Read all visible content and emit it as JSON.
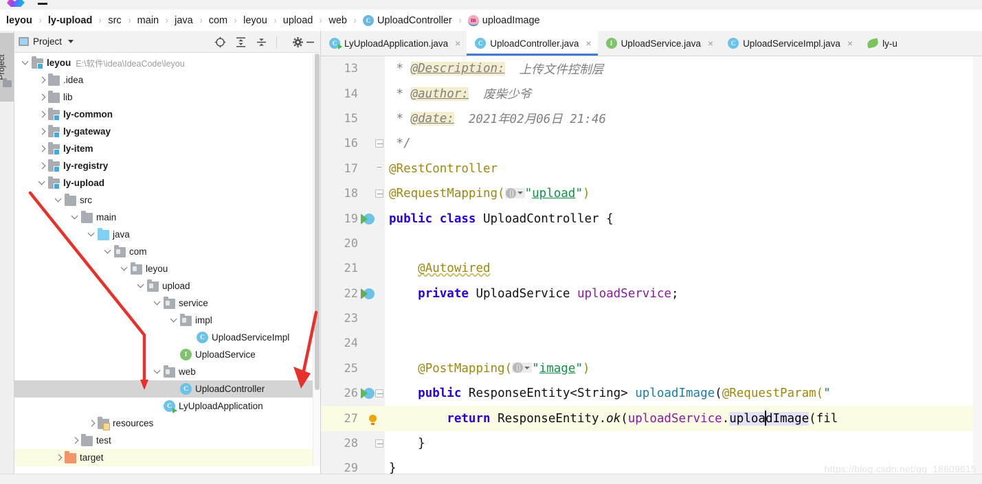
{
  "window": {
    "app": "IntelliJ IDEA",
    "watermark": "https://blog.csdn.net/qq_18609615"
  },
  "breadcrumb": {
    "items": [
      {
        "label": "leyou",
        "bold": true,
        "icon": ""
      },
      {
        "label": "ly-upload",
        "bold": true,
        "icon": ""
      },
      {
        "label": "src",
        "bold": false,
        "icon": ""
      },
      {
        "label": "main",
        "bold": false,
        "icon": ""
      },
      {
        "label": "java",
        "bold": false,
        "icon": ""
      },
      {
        "label": "com",
        "bold": false,
        "icon": ""
      },
      {
        "label": "leyou",
        "bold": false,
        "icon": ""
      },
      {
        "label": "upload",
        "bold": false,
        "icon": ""
      },
      {
        "label": "web",
        "bold": false,
        "icon": ""
      },
      {
        "label": "UploadController",
        "bold": false,
        "icon": "class-icon",
        "icon_letter": "C"
      },
      {
        "label": "uploadImage",
        "bold": false,
        "icon": "method-icon",
        "icon_letter": "m"
      }
    ],
    "separator": "›"
  },
  "tool_stripe": {
    "project_label": "Project",
    "folder_icon": "folder-icon"
  },
  "project_panel": {
    "title": "Project",
    "title_icon": "project-window-icon",
    "dropdown_icon": "chevron-down-icon",
    "toolbar": [
      {
        "name": "locate-target-icon",
        "tooltip": "Select Opened File"
      },
      {
        "name": "expand-all-icon",
        "tooltip": "Expand All"
      },
      {
        "name": "collapse-all-icon",
        "tooltip": "Collapse All"
      },
      {
        "name": "settings-gear-icon",
        "tooltip": "Settings"
      },
      {
        "name": "minimize-icon",
        "tooltip": "Hide"
      }
    ],
    "tree": [
      {
        "label": "leyou",
        "note": "E:\\软件\\idea\\IdeaCode\\leyou",
        "indent": 0,
        "arrow": "down",
        "icon": "module-folder-icon",
        "bold": true
      },
      {
        "label": ".idea",
        "note": "",
        "indent": 1,
        "arrow": "right",
        "icon": "folder-icon",
        "bold": false
      },
      {
        "label": "lib",
        "note": "",
        "indent": 1,
        "arrow": "right",
        "icon": "folder-icon",
        "bold": false
      },
      {
        "label": "ly-common",
        "note": "",
        "indent": 1,
        "arrow": "right",
        "icon": "module-folder-icon",
        "bold": true
      },
      {
        "label": "ly-gateway",
        "note": "",
        "indent": 1,
        "arrow": "right",
        "icon": "module-folder-icon",
        "bold": true
      },
      {
        "label": "ly-item",
        "note": "",
        "indent": 1,
        "arrow": "right",
        "icon": "module-folder-icon",
        "bold": true
      },
      {
        "label": "ly-registry",
        "note": "",
        "indent": 1,
        "arrow": "right",
        "icon": "module-folder-icon",
        "bold": true
      },
      {
        "label": "ly-upload",
        "note": "",
        "indent": 1,
        "arrow": "down",
        "icon": "module-folder-icon",
        "bold": true
      },
      {
        "label": "src",
        "note": "",
        "indent": 2,
        "arrow": "down",
        "icon": "folder-icon",
        "bold": false
      },
      {
        "label": "main",
        "note": "",
        "indent": 3,
        "arrow": "down",
        "icon": "folder-icon",
        "bold": false
      },
      {
        "label": "java",
        "note": "",
        "indent": 4,
        "arrow": "down",
        "icon": "source-folder-icon",
        "bold": false
      },
      {
        "label": "com",
        "note": "",
        "indent": 5,
        "arrow": "down",
        "icon": "package-icon",
        "bold": false
      },
      {
        "label": "leyou",
        "note": "",
        "indent": 6,
        "arrow": "down",
        "icon": "package-icon",
        "bold": false
      },
      {
        "label": "upload",
        "note": "",
        "indent": 7,
        "arrow": "down",
        "icon": "package-icon",
        "bold": false
      },
      {
        "label": "service",
        "note": "",
        "indent": 8,
        "arrow": "down",
        "icon": "package-icon",
        "bold": false
      },
      {
        "label": "impl",
        "note": "",
        "indent": 9,
        "arrow": "down",
        "icon": "package-icon",
        "bold": false
      },
      {
        "label": "UploadServiceImpl",
        "note": "",
        "indent": 10,
        "arrow": "",
        "icon": "class-icon",
        "bold": false
      },
      {
        "label": "UploadService",
        "note": "",
        "indent": 9,
        "arrow": "",
        "icon": "interface-icon",
        "bold": false
      },
      {
        "label": "web",
        "note": "",
        "indent": 8,
        "arrow": "down",
        "icon": "package-icon",
        "bold": false
      },
      {
        "label": "UploadController",
        "note": "",
        "indent": 9,
        "arrow": "",
        "icon": "class-icon",
        "bold": false,
        "selected": true
      },
      {
        "label": "LyUploadApplication",
        "note": "",
        "indent": 8,
        "arrow": "",
        "icon": "spring-app-icon",
        "bold": false
      },
      {
        "label": "resources",
        "note": "",
        "indent": 4,
        "arrow": "right",
        "icon": "resources-folder-icon",
        "bold": false
      },
      {
        "label": "test",
        "note": "",
        "indent": 3,
        "arrow": "right",
        "icon": "folder-icon",
        "bold": false
      },
      {
        "label": "target",
        "note": "",
        "indent": 2,
        "arrow": "right",
        "icon": "target-folder-icon",
        "bold": false,
        "highlight": true
      }
    ]
  },
  "editor_tabs": [
    {
      "label": "LyUploadApplication.java",
      "icon": "spring-app-icon",
      "icon_letter": "C",
      "active": false,
      "close": "×"
    },
    {
      "label": "UploadController.java",
      "icon": "class-icon",
      "icon_letter": "C",
      "active": true,
      "close": "×"
    },
    {
      "label": "UploadService.java",
      "icon": "interface-icon",
      "icon_letter": "I",
      "active": false,
      "close": "×"
    },
    {
      "label": "UploadServiceImpl.java",
      "icon": "class-icon",
      "icon_letter": "C",
      "active": false,
      "close": "×"
    },
    {
      "label": "ly-u",
      "icon": "yaml-leaf-icon",
      "icon_letter": "",
      "active": false,
      "close": ""
    }
  ],
  "editor": {
    "lines": [
      {
        "no": "13",
        "gutter": "",
        "fold": "",
        "current": false,
        "tokens": [
          {
            "t": " * ",
            "c": "c-doc"
          },
          {
            "t": "@Description:",
            "c": "c-tag"
          },
          {
            "t": "  上传文件控制层",
            "c": "c-doc"
          }
        ]
      },
      {
        "no": "14",
        "gutter": "",
        "fold": "",
        "current": false,
        "tokens": [
          {
            "t": " * ",
            "c": "c-doc"
          },
          {
            "t": "@author:",
            "c": "c-tag"
          },
          {
            "t": "  废柴少爷",
            "c": "c-doc"
          }
        ]
      },
      {
        "no": "15",
        "gutter": "",
        "fold": "",
        "current": false,
        "tokens": [
          {
            "t": " * ",
            "c": "c-doc"
          },
          {
            "t": "@date:",
            "c": "c-tag"
          },
          {
            "t": "  2021年02月06日 21:46",
            "c": "c-doc"
          }
        ]
      },
      {
        "no": "16",
        "gutter": "",
        "fold": "box",
        "current": false,
        "tokens": [
          {
            "t": " */",
            "c": "c-doc"
          }
        ]
      },
      {
        "no": "17",
        "gutter": "",
        "fold": "tri",
        "current": false,
        "tokens": [
          {
            "t": "@RestController",
            "c": "c-anno"
          }
        ]
      },
      {
        "no": "18",
        "gutter": "",
        "fold": "box",
        "current": false,
        "tokens": [
          {
            "t": "@RequestMapping(",
            "c": "c-anno"
          },
          {
            "t": "GLOBE",
            "c": "globe"
          },
          {
            "t": "\"",
            "c": "c-str"
          },
          {
            "t": "upload",
            "c": "c-str-u"
          },
          {
            "t": "\"",
            "c": "c-str"
          },
          {
            "t": ")",
            "c": "c-anno"
          }
        ]
      },
      {
        "no": "19",
        "gutter": "run-class",
        "fold": "",
        "current": false,
        "tokens": [
          {
            "t": "public ",
            "c": "c-kw"
          },
          {
            "t": "class ",
            "c": "c-kw"
          },
          {
            "t": "UploadController ",
            "c": "c-plain"
          },
          {
            "t": "{",
            "c": "c-plain"
          }
        ]
      },
      {
        "no": "20",
        "gutter": "",
        "fold": "",
        "current": false,
        "tokens": []
      },
      {
        "no": "21",
        "gutter": "",
        "fold": "",
        "current": false,
        "tokens": [
          {
            "t": "    ",
            "c": "c-plain"
          },
          {
            "t": "@Autowired",
            "c": "c-anno-w"
          }
        ]
      },
      {
        "no": "22",
        "gutter": "run-impl",
        "fold": "",
        "current": false,
        "tokens": [
          {
            "t": "    ",
            "c": "c-plain"
          },
          {
            "t": "private ",
            "c": "c-kw"
          },
          {
            "t": "UploadService ",
            "c": "c-plain"
          },
          {
            "t": "uploadService",
            "c": "c-field"
          },
          {
            "t": ";",
            "c": "c-plain"
          }
        ]
      },
      {
        "no": "23",
        "gutter": "",
        "fold": "",
        "current": false,
        "tokens": []
      },
      {
        "no": "24",
        "gutter": "",
        "fold": "",
        "current": false,
        "tokens": []
      },
      {
        "no": "25",
        "gutter": "",
        "fold": "",
        "current": false,
        "tokens": [
          {
            "t": "    ",
            "c": "c-plain"
          },
          {
            "t": "@PostMapping(",
            "c": "c-anno"
          },
          {
            "t": "GLOBE",
            "c": "globe"
          },
          {
            "t": "\"",
            "c": "c-str"
          },
          {
            "t": "image",
            "c": "c-str-u"
          },
          {
            "t": "\"",
            "c": "c-str"
          },
          {
            "t": ")",
            "c": "c-anno"
          }
        ]
      },
      {
        "no": "26",
        "gutter": "run-class",
        "fold": "box",
        "current": false,
        "tokens": [
          {
            "t": "    ",
            "c": "c-plain"
          },
          {
            "t": "public ",
            "c": "c-kw"
          },
          {
            "t": "ResponseEntity<String> ",
            "c": "c-plain"
          },
          {
            "t": "uploadImage",
            "c": "c-method"
          },
          {
            "t": "(",
            "c": "c-plain"
          },
          {
            "t": "@RequestParam(",
            "c": "c-anno"
          },
          {
            "t": "\"",
            "c": "c-str"
          },
          {
            "t": "​",
            "c": "c-str-u"
          }
        ]
      },
      {
        "no": "27",
        "gutter": "bulb",
        "fold": "",
        "current": true,
        "tokens": [
          {
            "t": "        ",
            "c": "c-plain"
          },
          {
            "t": "return ",
            "c": "c-kw"
          },
          {
            "t": "ResponseEntity.",
            "c": "c-plain"
          },
          {
            "t": "ok",
            "c": "c-static"
          },
          {
            "t": "(",
            "c": "c-plain"
          },
          {
            "t": "uploadService",
            "c": "c-field"
          },
          {
            "t": ".",
            "c": "c-plain"
          },
          {
            "t": "HL_uploa",
            "c": "hl-ident"
          },
          {
            "t": "CARET",
            "c": "caret"
          },
          {
            "t": "HL_dImage",
            "c": "hl-ident"
          },
          {
            "t": "(fil",
            "c": "c-plain"
          }
        ]
      },
      {
        "no": "28",
        "gutter": "",
        "fold": "box",
        "current": false,
        "tokens": [
          {
            "t": "    }",
            "c": "c-plain"
          }
        ]
      },
      {
        "no": "29",
        "gutter": "",
        "fold": "",
        "current": false,
        "tokens": [
          {
            "t": "}",
            "c": "c-plain"
          }
        ]
      }
    ]
  }
}
